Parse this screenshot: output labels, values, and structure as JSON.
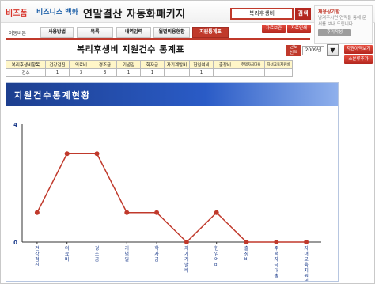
{
  "header": {
    "logo_brand": "비즈폼",
    "logo_sub": "비즈니스 백화",
    "app_title": "연말결산 자동화패키지",
    "search_value": "복리후생비",
    "search_button": "검색"
  },
  "help_box": {
    "title": "채용상기함",
    "text": "남겨주시면 연락을 통해 문서를 보내 드립니다.",
    "button": "후기작성"
  },
  "nav": {
    "label": "이동비튼",
    "tabs": [
      "사용방법",
      "목록",
      "내역입력",
      "월별비용현황",
      "지원통계표"
    ],
    "active_tab": 4,
    "util_buttons": [
      "자료보관",
      "자료인쇄"
    ]
  },
  "summary": {
    "title": "복리후생비 지원건수 통계표",
    "year_label": "년도\n선택",
    "year_value": "2009년",
    "side_buttons": [
      "지원이력보기",
      "소분류추가"
    ],
    "columns": [
      "복리후생비항목",
      "건강검진",
      "의료비",
      "경조금",
      "기념일",
      "학자금",
      "자기계발비",
      "헌임여비",
      "출장비",
      "주택자금대출",
      "자녀교육지원비"
    ],
    "row_label": "건수",
    "row_values": [
      "1",
      "3",
      "3",
      "1",
      "1",
      "",
      "1",
      "",
      "",
      ""
    ]
  },
  "chart_panel": {
    "banner_title": "지원건수통계현황"
  },
  "chart_data": {
    "type": "line",
    "categories": [
      "건강검진",
      "의료비",
      "경조금",
      "기념일",
      "학자금",
      "자기계발비",
      "헌임여비",
      "출장비",
      "주택자금대출",
      "자녀교육지원비"
    ],
    "series": [
      {
        "values": [
          1,
          3,
          3,
          1,
          1,
          0,
          1,
          0,
          0,
          0
        ]
      }
    ],
    "ylim": [
      0,
      4
    ],
    "yticks": [
      "0",
      "4"
    ],
    "title": "",
    "xlabel": "",
    "ylabel": "",
    "line_color": "#c0392b"
  }
}
